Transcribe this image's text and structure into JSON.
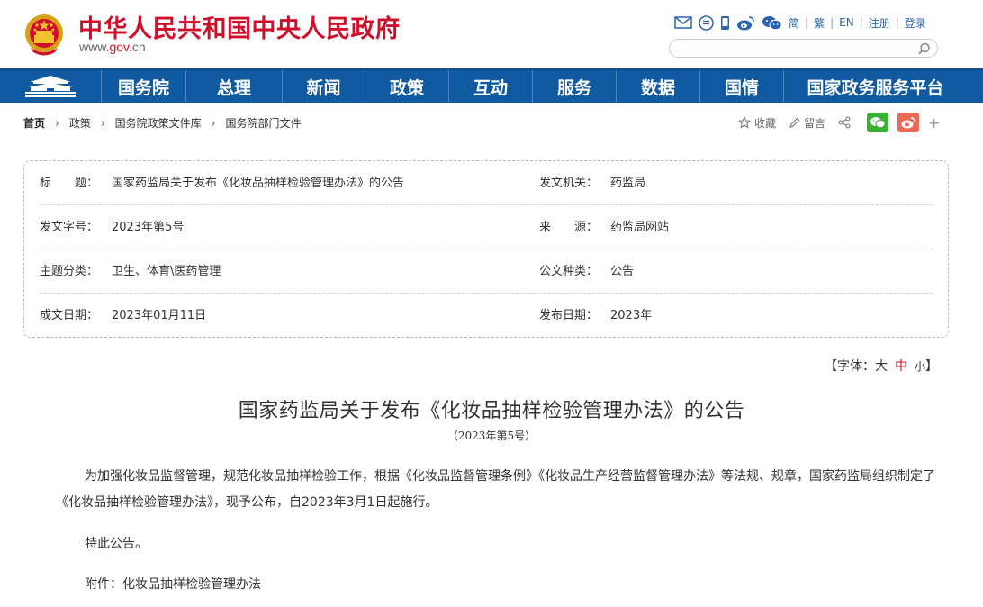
{
  "header": {
    "site_title": "中华人民共和国中央人民政府",
    "url_prefix": "www.",
    "url_gov": "gov",
    "url_suffix": ".cn",
    "lang_simplified": "简",
    "lang_traditional": "繁",
    "lang_en": "EN",
    "register": "注册",
    "login": "登录",
    "search_placeholder": ""
  },
  "nav": {
    "items": [
      "国务院",
      "总理",
      "新闻",
      "政策",
      "互动",
      "服务",
      "数据",
      "国情",
      "国家政务服务平台"
    ]
  },
  "breadcrumb": {
    "items": [
      "首页",
      "政策",
      "国务院政策文件库",
      "国务院部门文件"
    ]
  },
  "share": {
    "favorite": "收藏",
    "comment": "留言",
    "more": "+"
  },
  "info": {
    "title_label": "标　　题：",
    "title_value": "国家药监局关于发布《化妆品抽样检验管理办法》的公告",
    "issuer_label": "发文机关：",
    "issuer_value": "药监局",
    "doc_no_label": "发文字号：",
    "doc_no_value": "2023年第5号",
    "source_label": "来　　源：",
    "source_value": "药监局网站",
    "topic_label": "主题分类：",
    "topic_value": "卫生、体育\\医药管理",
    "type_label": "公文种类：",
    "type_value": "公告",
    "written_label": "成文日期：",
    "written_value": "2023年01月11日",
    "publish_label": "发布日期：",
    "publish_value": "2023年"
  },
  "fontsize": {
    "prefix": "【字体：",
    "big": "大",
    "mid": "中",
    "small": "小",
    "suffix": "】"
  },
  "article": {
    "title": "国家药监局关于发布《化妆品抽样检验管理办法》的公告",
    "doc_no": "（2023年第5号）",
    "p1": "为加强化妆品监督管理，规范化妆品抽样检验工作，根据《化妆品监督管理条例》《化妆品生产经营监督管理办法》等法规、规章，国家药监局组织制定了《化妆品抽样检验管理办法》，现予公布，自2023年3月1日起施行。",
    "p2": "特此公告。",
    "p3": "附件：化妆品抽样检验管理办法"
  },
  "colors": {
    "brand_red": "#d0102b",
    "nav_blue": "#0f5aa0",
    "link_blue": "#2a64b1",
    "wechat_green": "#3cb034",
    "weibo_red": "#e96a57"
  }
}
